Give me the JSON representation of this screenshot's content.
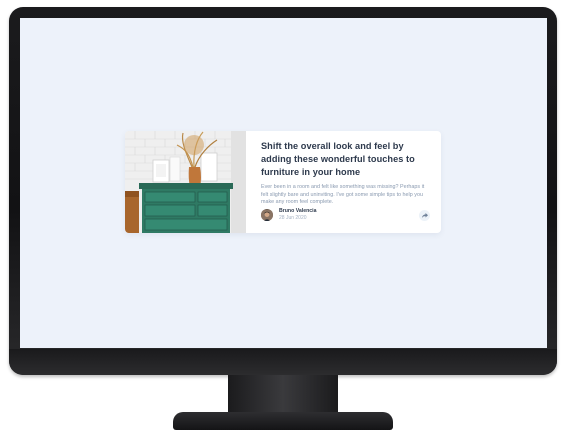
{
  "colors": {
    "screen_background": "#edf2fa",
    "card_background": "#ffffff",
    "title_text": "#2e3a4d",
    "body_text": "#8a9ab0",
    "share_button_bg": "#ecf2f8",
    "monitor_frame": "#121214"
  },
  "article": {
    "title": "Shift the overall look and feel by adding these wonderful touches to furniture in your home",
    "description": "Ever been in a room and felt like something was missing? Perhaps it felt slightly bare and uninviting. I've got some simple tips to help you make any room feel complete.",
    "image_icon": "green-drawers-photo"
  },
  "author": {
    "name": "Bruno Valencia",
    "date": "28 Jun 2020",
    "avatar_icon": "author-avatar"
  },
  "share": {
    "icon": "share-icon"
  }
}
